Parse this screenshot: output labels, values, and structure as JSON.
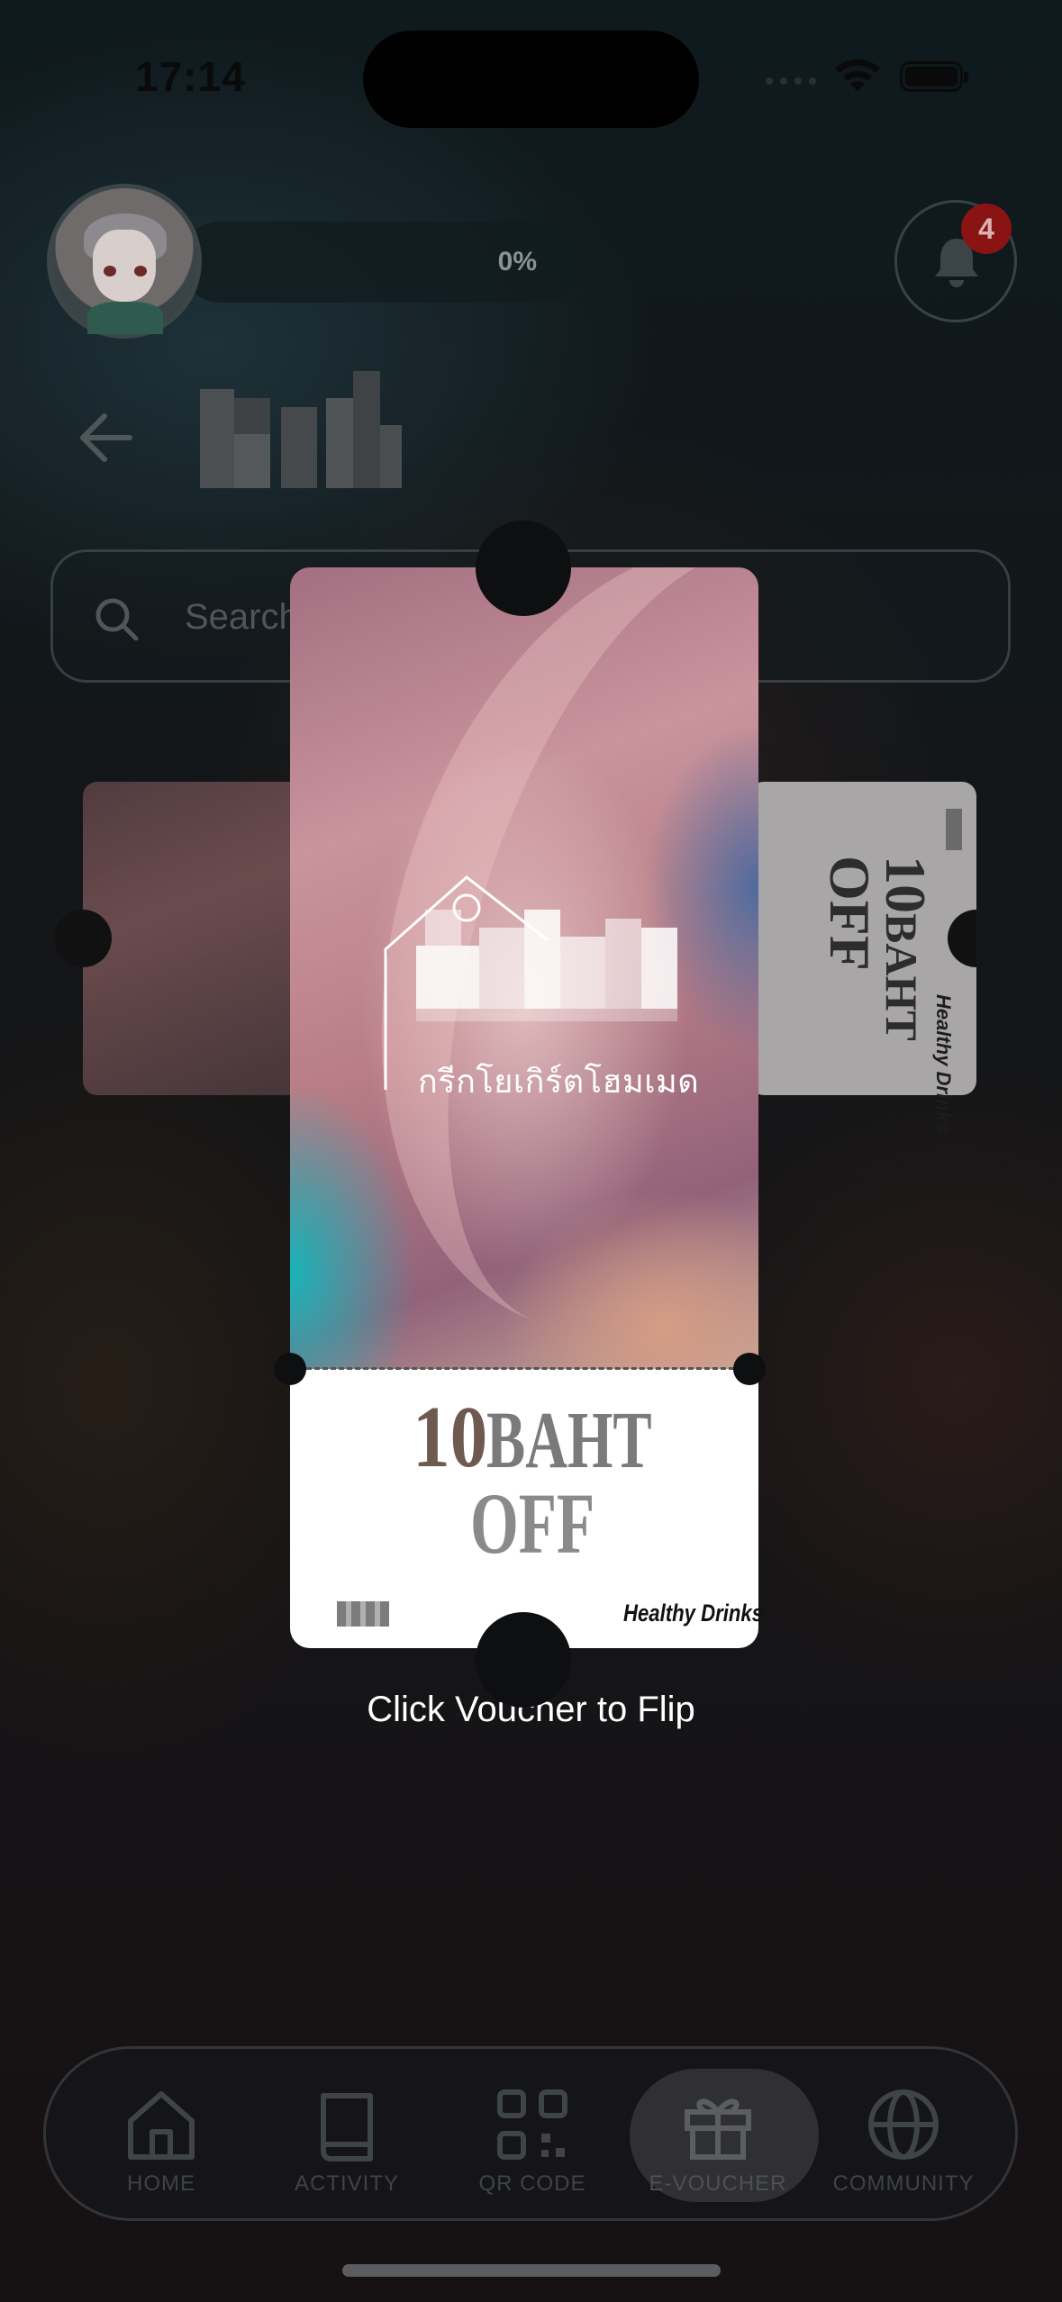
{
  "status_bar": {
    "time": "17:14"
  },
  "header": {
    "progress_text": "0%",
    "notification_count": "4",
    "icons": {
      "avatar": "user-avatar",
      "bell": "bell-icon",
      "back": "arrow-left-icon"
    }
  },
  "search": {
    "placeholder": "Search",
    "icon": "search-icon"
  },
  "voucher": {
    "brand_thai": "กรีกโยเกิร์ตโฮมเมด",
    "amount": "10",
    "currency": "BAHT",
    "off": "OFF",
    "shop": "Healthy Drinks",
    "hint": "Click Voucher to Flip"
  },
  "side_voucher": {
    "amount": "10",
    "currency": "BAHT",
    "off": "OFF",
    "shop": "Healthy Drinks"
  },
  "nav": {
    "items": [
      {
        "label": "HOME",
        "icon": "home-icon"
      },
      {
        "label": "ACTIVITY",
        "icon": "book-icon"
      },
      {
        "label": "QR CODE",
        "icon": "qr-code-icon"
      },
      {
        "label": "E-VOUCHER",
        "icon": "gift-icon",
        "active": true
      },
      {
        "label": "COMMUNITY",
        "icon": "globe-icon"
      }
    ]
  },
  "colors": {
    "badge": "#8a1414",
    "overlay": "#0b1013",
    "voucher_bottom": "#ffffff"
  }
}
